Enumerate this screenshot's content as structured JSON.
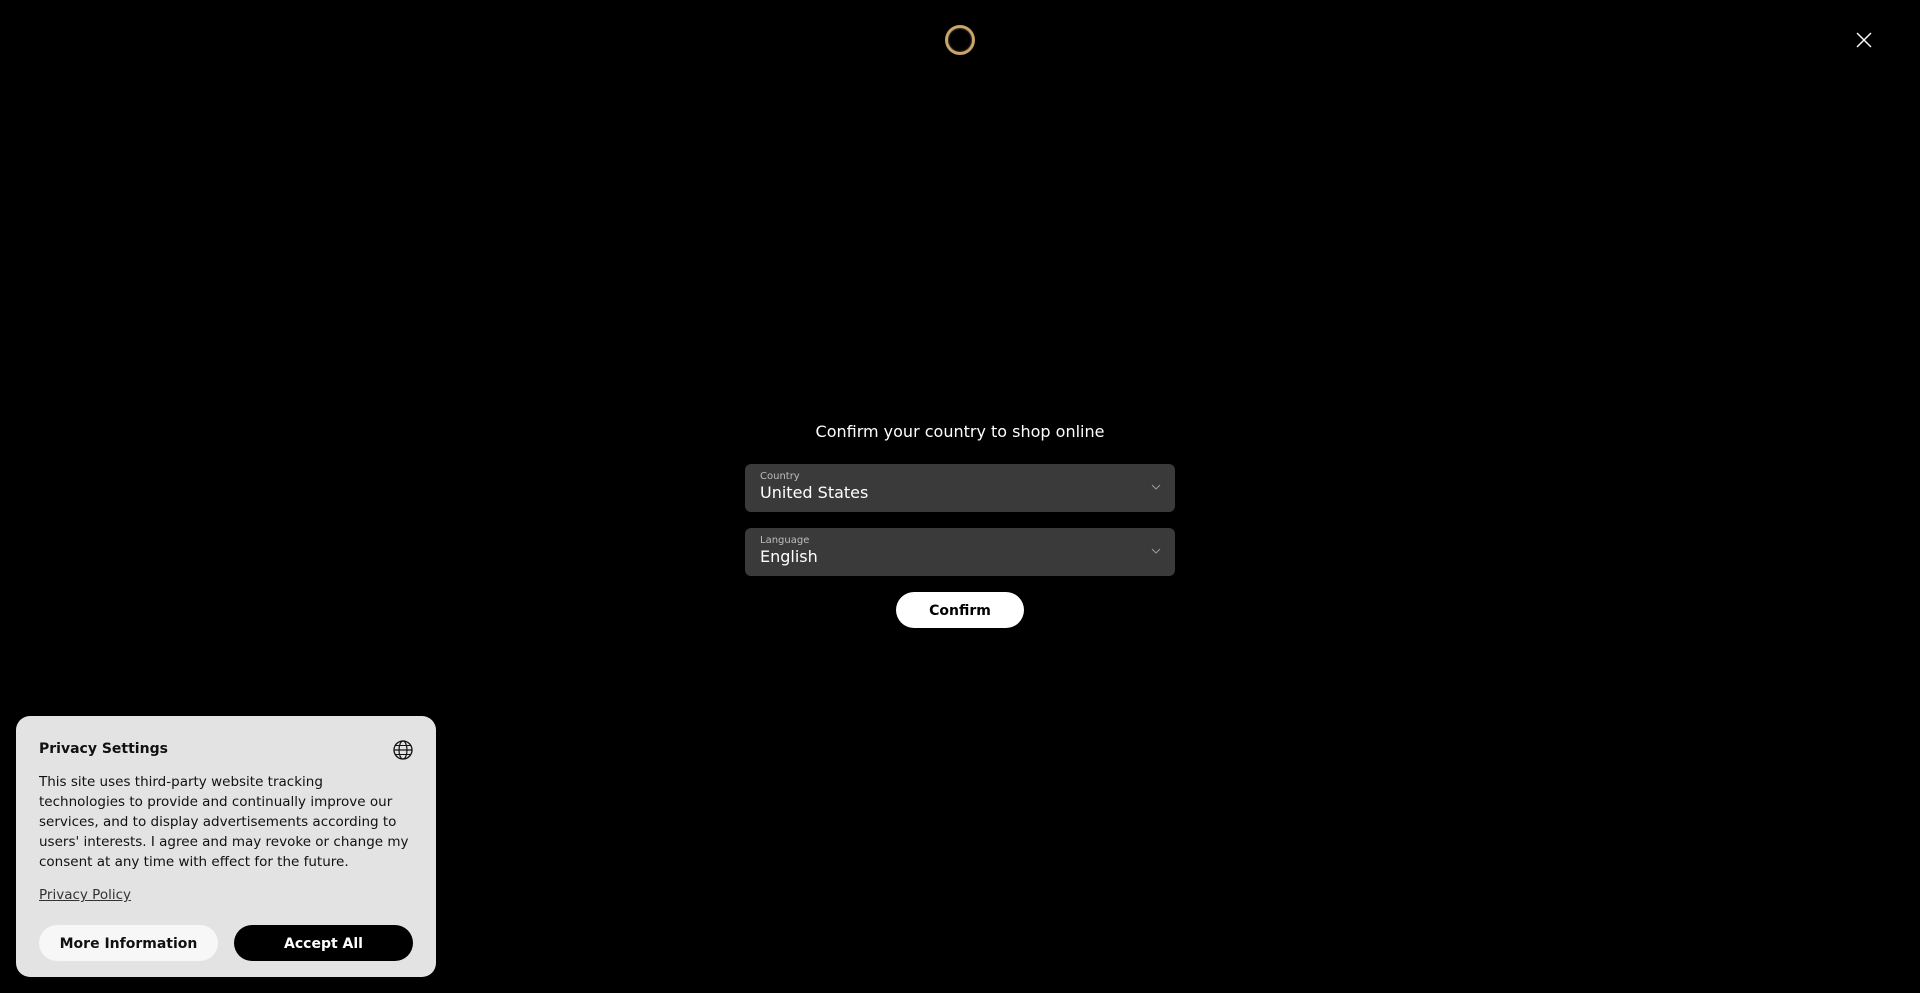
{
  "header": {
    "logo_icon": "ring-logo-icon",
    "close_icon": "close-icon"
  },
  "country_modal": {
    "heading": "Confirm your country to shop online",
    "country": {
      "label": "Country",
      "value": "United States"
    },
    "language": {
      "label": "Language",
      "value": "English"
    },
    "confirm_label": "Confirm"
  },
  "privacy": {
    "title": "Privacy Settings",
    "icon": "globe-icon",
    "text": "This site uses third-party website tracking technologies to provide and continually improve our services, and to display advertisements according to users' interests. I agree and may revoke or change my consent at any time with effect for the future.",
    "policy_link": "Privacy Policy",
    "more_info_label": "More Information",
    "accept_all_label": "Accept All"
  },
  "colors": {
    "background": "#000000",
    "logo_ring": "#c9a56a",
    "select_bg": "#3a3a3a",
    "privacy_bg": "#e3e3e3"
  }
}
